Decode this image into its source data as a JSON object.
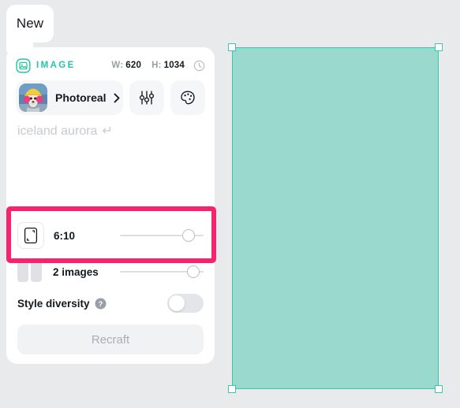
{
  "tab": {
    "label": "New"
  },
  "panel": {
    "header": {
      "type_icon": "image-icon",
      "type_label": "IMAGE",
      "width_key": "W:",
      "width_value": "620",
      "height_key": "H:",
      "height_value": "1034",
      "history_icon": "clock-icon"
    },
    "style": {
      "thumbnail_alt": "dog-photoreal-thumbnail",
      "name": "Photoreal",
      "chevron_icon": "chevron-right-icon",
      "settings_icon": "sliders-icon",
      "palette_icon": "palette-icon"
    },
    "prompt": {
      "text": "iceland aurora",
      "enter_symbol": "↵"
    },
    "aspect_ratio": {
      "icon": "portrait-crop-icon",
      "label": "6:10",
      "slider_value": 88
    },
    "images_count": {
      "icon": "two-images-icon",
      "label": "2 images",
      "slider_value": 94
    },
    "style_diversity": {
      "label": "Style diversity",
      "help_icon": "question-mark-icon",
      "enabled": false
    },
    "recraft_button": {
      "label": "Recraft"
    }
  },
  "canvas": {
    "selection": {
      "fill_color": "#9ad9cd",
      "stroke_color": "#3cc4ae",
      "handles": [
        "top-left",
        "top-right",
        "bottom-left",
        "bottom-right"
      ]
    }
  },
  "annotation": {
    "highlight_color": "#f4246e",
    "target": "aspect-ratio-row"
  },
  "colors": {
    "background": "#e9eaec",
    "panel": "#ffffff",
    "accent_teal": "#27c4a4",
    "text_primary": "#14181f",
    "text_muted": "#9aa0a8"
  }
}
